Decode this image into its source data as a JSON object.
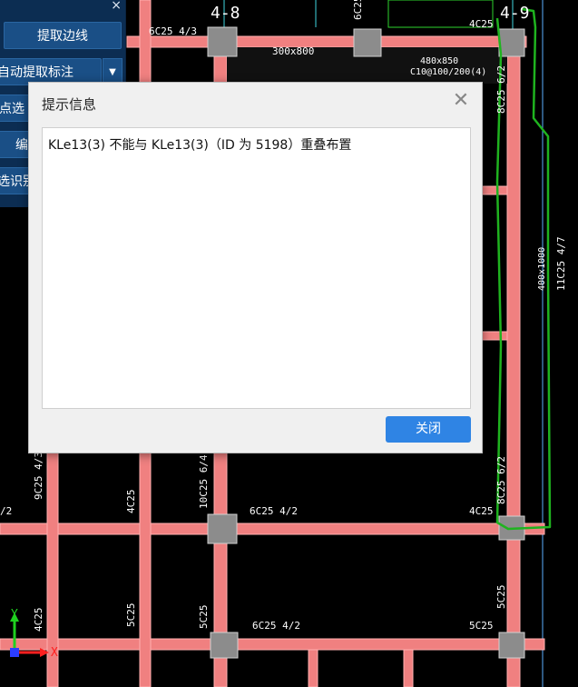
{
  "panel": {
    "buttons": [
      "提取边线",
      "自动提取标注",
      "点选",
      "编",
      "选识别"
    ],
    "close_glyph": "×",
    "dropdown_glyph": "▼"
  },
  "dialog": {
    "title": "提示信息",
    "close_glyph": "✕",
    "message": "KLe13(3) 不能与 KLe13(3)（ID 为 5198）重叠布置",
    "ok_label": "关闭"
  },
  "cad": {
    "axis_labels": [
      "4-8",
      "4-9"
    ],
    "annotations": [
      "6C25",
      "6C25 4/3",
      "4C25",
      "300x800",
      "480x850",
      "C10@100/200(4)",
      "8C25 6/2",
      "400x1000",
      "11C25 4/7",
      "9C25 4/3",
      "4C25",
      "10C25 6/4",
      "6C25 4/2",
      "4C25",
      "8C25 6/2",
      "5C25",
      "4C25",
      "5C25",
      "6C25 4/2",
      "5C25",
      "/2"
    ],
    "ucs_labels": [
      "Y",
      "X"
    ],
    "colors": {
      "beam": "#f08080",
      "column": "#8c8c8c",
      "markup": "#1fb31f",
      "axis": "#3fd6e0"
    }
  }
}
